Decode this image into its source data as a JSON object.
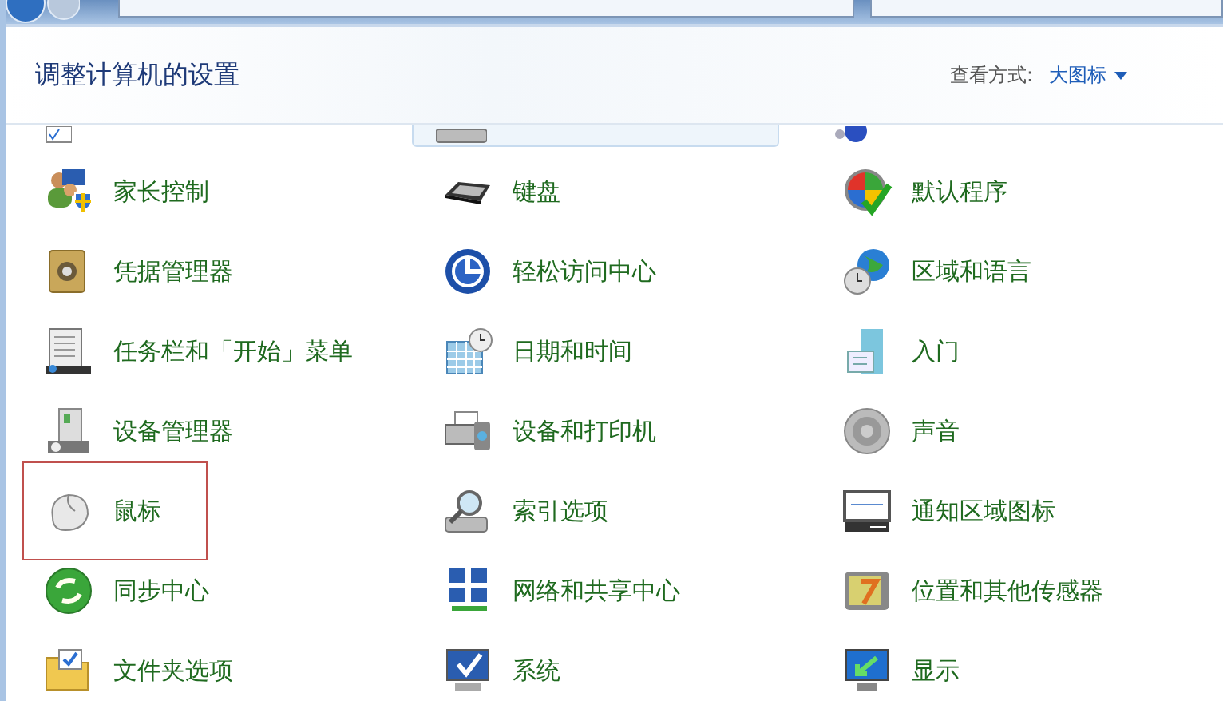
{
  "header": {
    "title": "调整计算机的设置",
    "view_by_label": "查看方式:",
    "view_by_value": "大图标"
  },
  "partial_row": [
    {
      "hovered": false
    },
    {
      "hovered": true
    },
    {
      "hovered": false
    }
  ],
  "items": [
    {
      "label": "家长控制",
      "highlighted": false
    },
    {
      "label": "键盘",
      "highlighted": false
    },
    {
      "label": "默认程序",
      "highlighted": false
    },
    {
      "label": "凭据管理器",
      "highlighted": false
    },
    {
      "label": "轻松访问中心",
      "highlighted": false
    },
    {
      "label": "区域和语言",
      "highlighted": false
    },
    {
      "label": "任务栏和「开始」菜单",
      "highlighted": false
    },
    {
      "label": "日期和时间",
      "highlighted": false
    },
    {
      "label": "入门",
      "highlighted": false
    },
    {
      "label": "设备管理器",
      "highlighted": false
    },
    {
      "label": "设备和打印机",
      "highlighted": false
    },
    {
      "label": "声音",
      "highlighted": false
    },
    {
      "label": "鼠标",
      "highlighted": true
    },
    {
      "label": "索引选项",
      "highlighted": false
    },
    {
      "label": "通知区域图标",
      "highlighted": false
    },
    {
      "label": "同步中心",
      "highlighted": false
    },
    {
      "label": "网络和共享中心",
      "highlighted": false
    },
    {
      "label": "位置和其他传感器",
      "highlighted": false
    },
    {
      "label": "文件夹选项",
      "highlighted": false
    },
    {
      "label": "系统",
      "highlighted": false
    },
    {
      "label": "显示",
      "highlighted": false
    }
  ]
}
